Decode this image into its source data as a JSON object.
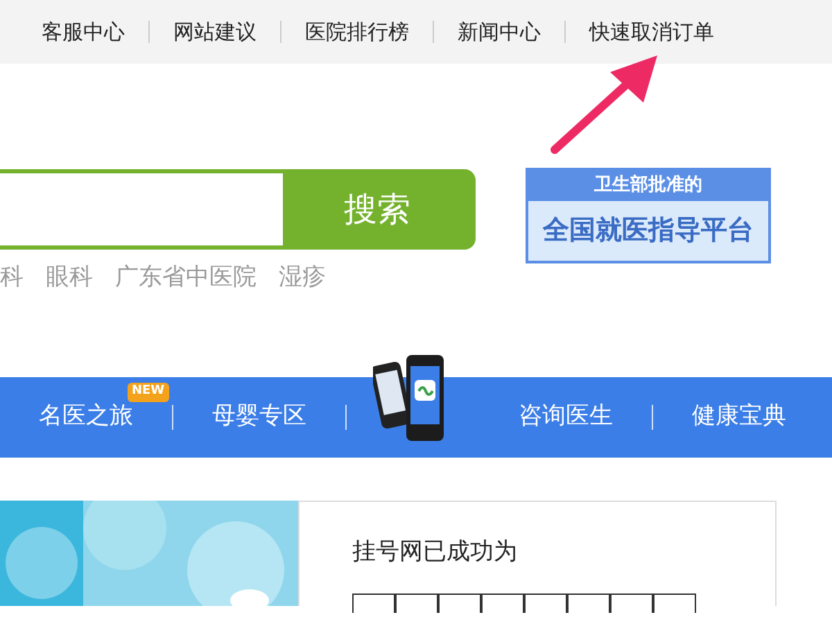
{
  "top_links": [
    "客服中心",
    "网站建议",
    "医院排行榜",
    "新闻中心",
    "快速取消订单"
  ],
  "search": {
    "button": "搜索",
    "suggestions": [
      "科",
      "眼科",
      "广东省中医院",
      "湿疹"
    ]
  },
  "badge": {
    "top": "卫生部批准的",
    "main": "全国就医指导平台"
  },
  "nav": [
    {
      "label": "名医之旅",
      "new": "NEW",
      "kind": "link"
    },
    {
      "label": "母婴专区",
      "kind": "link"
    },
    {
      "kind": "app"
    },
    {
      "label": "咨询医生",
      "kind": "link"
    },
    {
      "label": "健康宝典",
      "kind": "link"
    }
  ],
  "promo": {
    "headline": "挂号网已成功为"
  }
}
